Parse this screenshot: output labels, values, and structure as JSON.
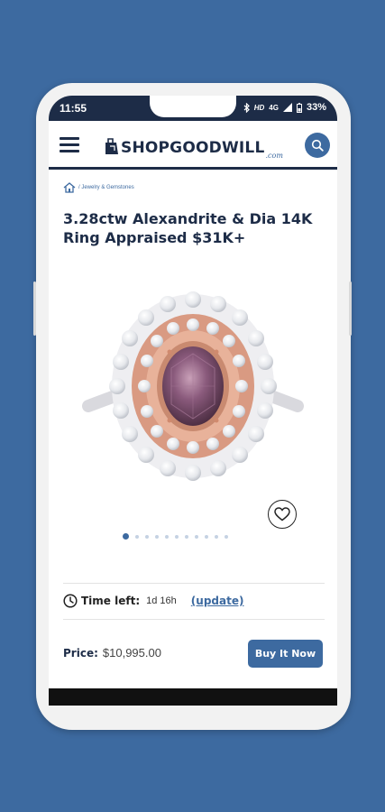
{
  "status_bar": {
    "time": "11:55",
    "icons": [
      "bluetooth-icon",
      "hd-icon",
      "4g-icon",
      "signal-icon",
      "battery-icon"
    ],
    "hd_label": "HD",
    "network_label": "4G",
    "battery_percent": "33%"
  },
  "header": {
    "logo_text": "SHOPGOODWILL",
    "logo_suffix": ".com",
    "menu_icon": "hamburger-menu-icon",
    "search_icon": "search-icon"
  },
  "breadcrumb": {
    "home_icon": "home-icon",
    "path": "/ Jewelry & Gemstones"
  },
  "product": {
    "title": "3.28ctw Alexandrite & Dia 14K Ring Appraised $31K+",
    "image_count": 11,
    "active_image_index": 0,
    "favorite_icon": "heart-icon"
  },
  "auction": {
    "clock_icon": "clock-icon",
    "time_left_label": "Time left:",
    "time_left_value": "1d 16h",
    "update_label": "(update)",
    "price_label": "Price:",
    "price_value": "$10,995.00",
    "buy_label": "Buy It Now"
  },
  "colors": {
    "background": "#3d6aa0",
    "brand_navy": "#1d2c47",
    "accent_blue": "#3d6aa0"
  }
}
